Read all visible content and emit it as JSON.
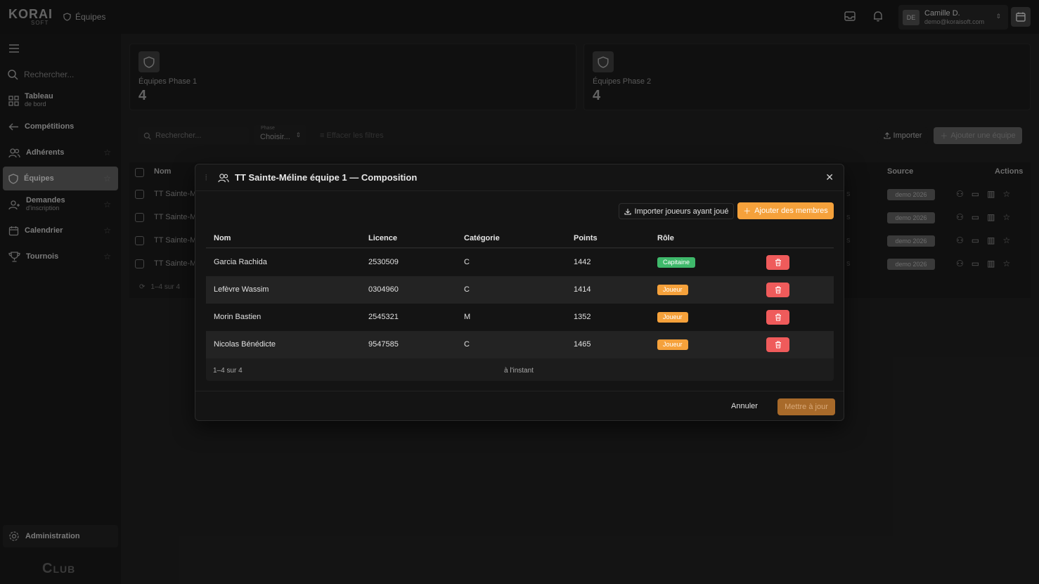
{
  "app": {
    "logo": "KORAI",
    "logo_sub": "SOFT",
    "breadcrumb": "Équipes"
  },
  "user": {
    "initials": "DE",
    "name": "Camille D.",
    "email": "demo@koraisoft.com"
  },
  "sidebar": {
    "search_placeholder": "Rechercher...",
    "items": [
      {
        "label": "Tableau",
        "sub": "de bord",
        "icon": "grid-icon"
      },
      {
        "label": "Compétitions",
        "icon": "arrow-left-icon"
      },
      {
        "label": "Adhérents",
        "icon": "users-icon"
      },
      {
        "label": "Équipes",
        "icon": "shield-icon"
      },
      {
        "label": "Demandes",
        "sub": "d'inscription",
        "icon": "user-plus-icon"
      },
      {
        "label": "Calendrier",
        "icon": "calendar-icon"
      },
      {
        "label": "Tournois",
        "icon": "trophy-icon"
      }
    ],
    "admin": "Administration",
    "club": "Club"
  },
  "stats": [
    {
      "label": "Équipes Phase 1",
      "value": "4"
    },
    {
      "label": "Équipes Phase 2",
      "value": "4"
    }
  ],
  "filters": {
    "search_placeholder": "Rechercher...",
    "phase_label": "Phase",
    "phase_value": "Choisir...",
    "clear": "Effacer les filtres",
    "import": "Importer",
    "add_team": "Ajouter une équipe"
  },
  "bg_table": {
    "col_name": "Nom",
    "col_source": "Source",
    "col_actions": "Actions",
    "rows": [
      {
        "name": "TT Sainte-M",
        "source": "demo 2026"
      },
      {
        "name": "TT Sainte-M",
        "source": "demo 2026"
      },
      {
        "name": "TT Sainte-M",
        "source": "demo 2026"
      },
      {
        "name": "TT Sainte-M",
        "source": "demo 2026"
      }
    ],
    "footer": "1–4 sur 4"
  },
  "modal": {
    "title": "TT Sainte-Méline équipe 1 — Composition",
    "import_players": "Importer joueurs ayant joué",
    "add_members": "Ajouter des membres",
    "columns": [
      "Nom",
      "Licence",
      "Catégorie",
      "Points",
      "Rôle"
    ],
    "rows": [
      {
        "name": "Garcia Rachida",
        "licence": "2530509",
        "category": "C",
        "points": "1442",
        "role": "Capitaine",
        "role_color": "#3fb96b"
      },
      {
        "name": "Lefèvre Wassim",
        "licence": "0304960",
        "category": "C",
        "points": "1414",
        "role": "Joueur",
        "role_color": "#f5a13b"
      },
      {
        "name": "Morin Bastien",
        "licence": "2545321",
        "category": "M",
        "points": "1352",
        "role": "Joueur",
        "role_color": "#f5a13b"
      },
      {
        "name": "Nicolas Bénédicte",
        "licence": "9547585",
        "category": "C",
        "points": "1465",
        "role": "Joueur",
        "role_color": "#f5a13b"
      }
    ],
    "footer_count": "1–4 sur 4",
    "footer_time": "à l'instant",
    "cancel": "Annuler",
    "update": "Mettre à jour"
  }
}
